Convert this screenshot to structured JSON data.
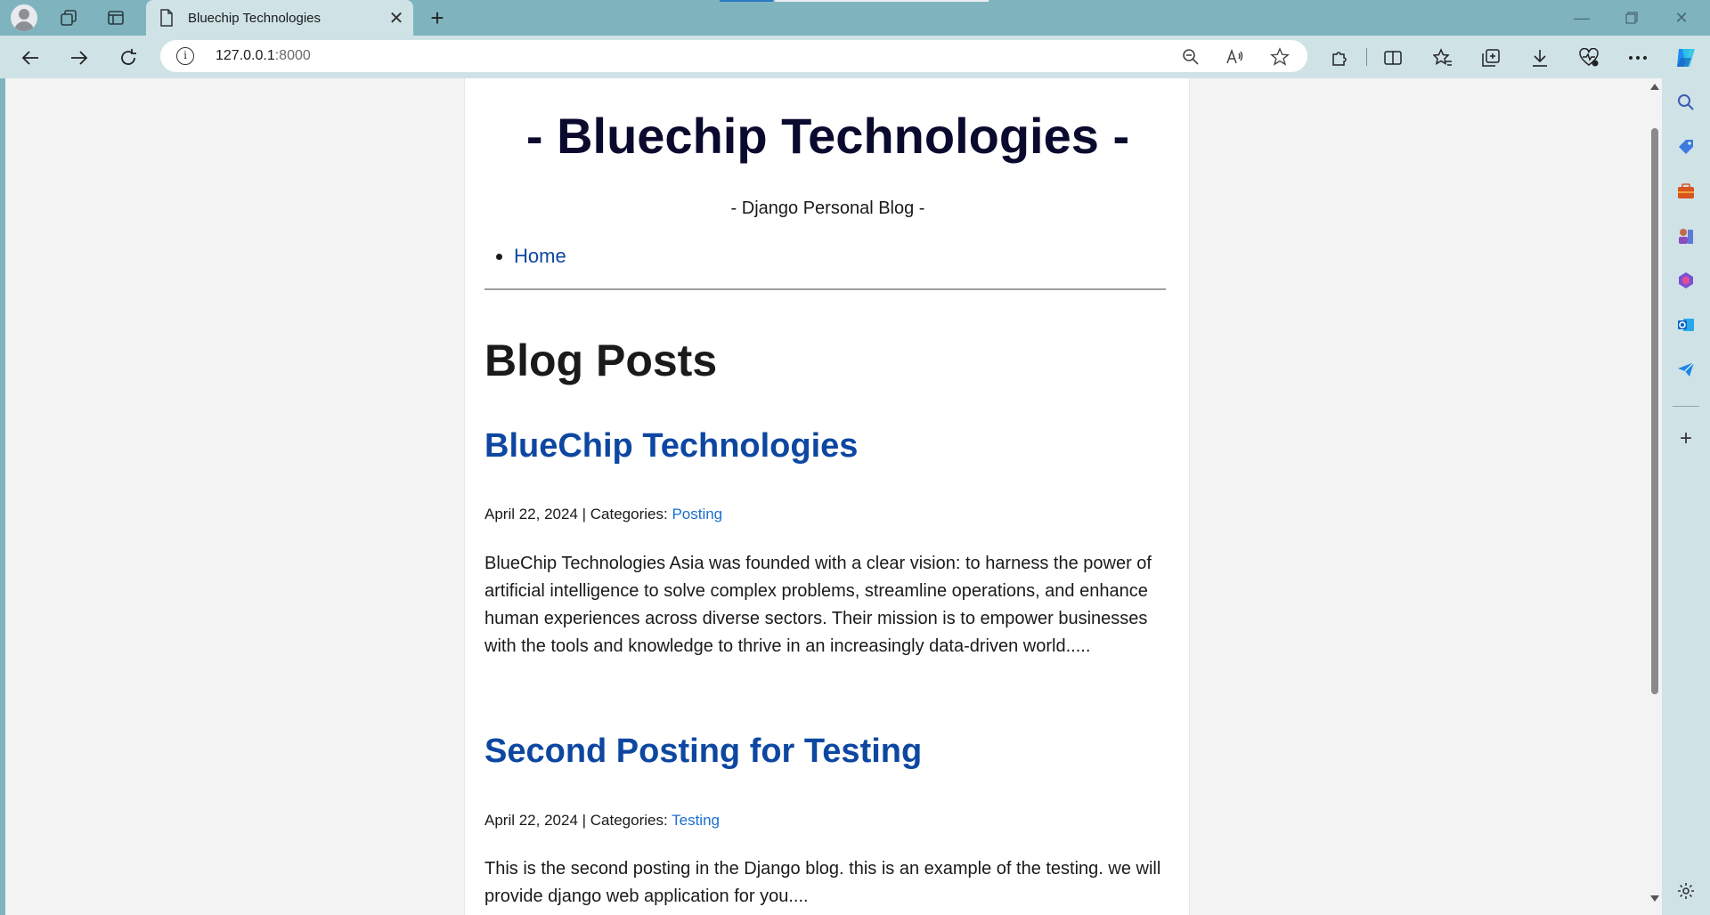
{
  "browser": {
    "tab": {
      "title": "Bluechip Technologies"
    },
    "address": {
      "host": "127.0.0.1",
      "port": ":8000"
    }
  },
  "page": {
    "site_title": "- Bluechip Technologies -",
    "site_subtitle": "- Django Personal Blog -",
    "nav": [
      {
        "label": "Home"
      }
    ],
    "heading": "Blog Posts",
    "posts": [
      {
        "title": "BlueChip Technologies",
        "meta_prefix": "April 22, 2024 | Categories: ",
        "category": "Posting",
        "excerpt": "BlueChip Technologies Asia was founded with a clear vision: to harness the power of artificial intelligence to solve complex problems, streamline operations, and enhance human experiences across diverse sectors. Their mission is to empower businesses with the tools and knowledge to thrive in an increasingly data-driven world....."
      },
      {
        "title": "Second Posting for Testing",
        "meta_prefix": "April 22, 2024 | Categories: ",
        "category": "Testing",
        "excerpt": "This is the second posting in the Django blog. this is an example of the testing. we will provide django web application for you...."
      }
    ]
  },
  "colors": {
    "chrome": "#7fb4bf",
    "toolbar": "#cfe3e7",
    "link": "#0d47a1",
    "category_link": "#1a6fd0",
    "title": "#0a0a2e"
  }
}
